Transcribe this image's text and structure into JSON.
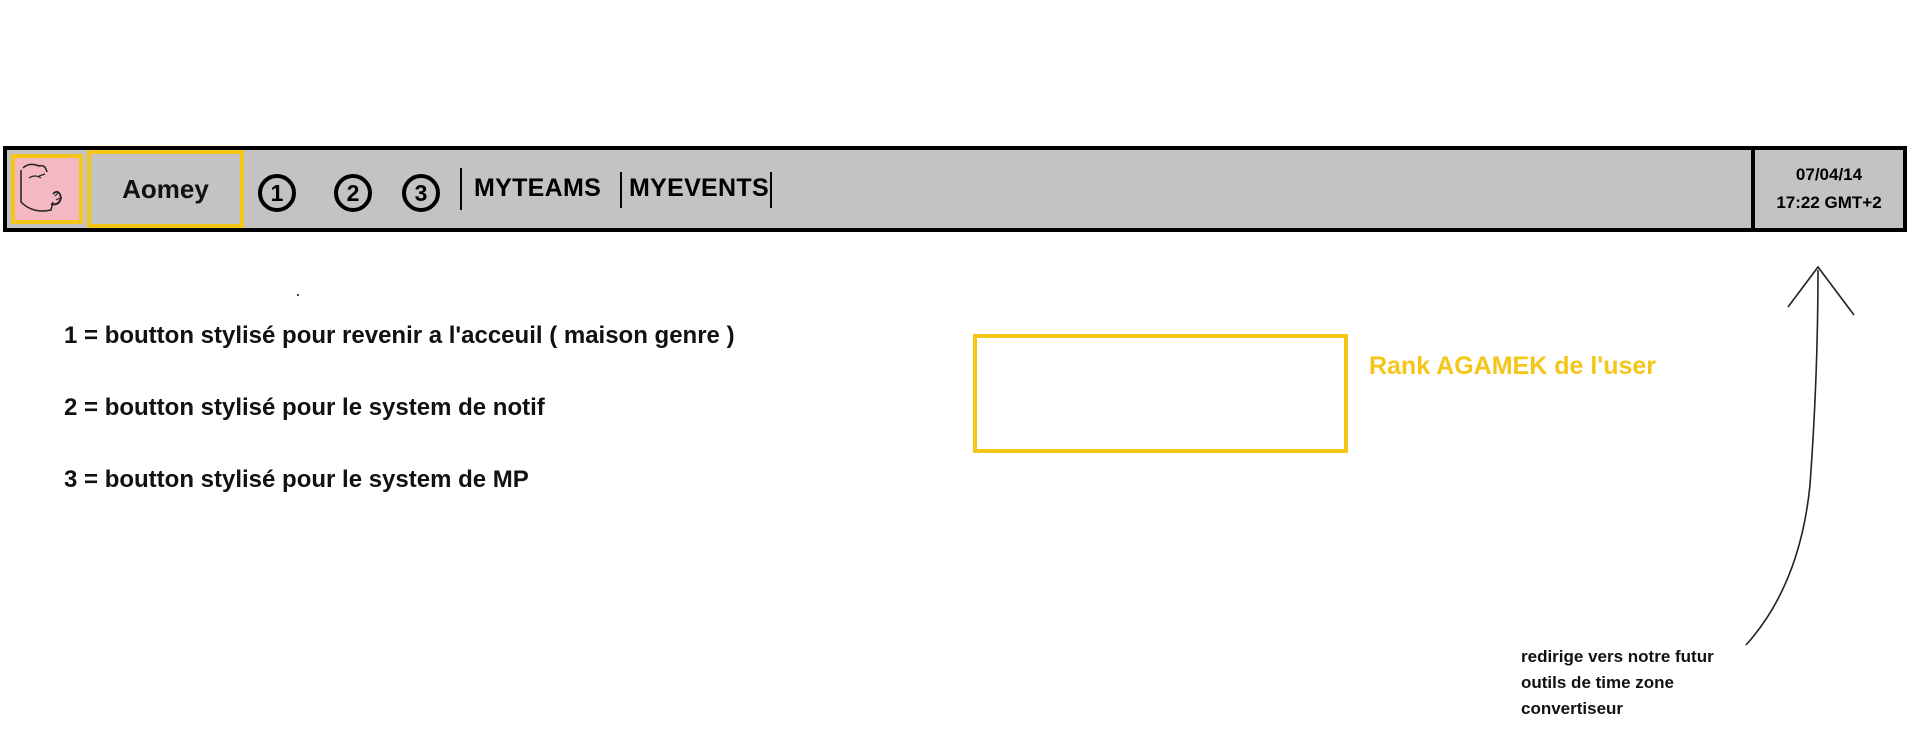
{
  "topbar": {
    "username": "Aomey",
    "buttons": [
      {
        "label": "1",
        "icon": "home-button"
      },
      {
        "label": "2",
        "icon": "notification-button"
      },
      {
        "label": "3",
        "icon": "private-message-button"
      }
    ],
    "nav": {
      "myteams": "MYTEAMS",
      "myevents": "MYEVENTS"
    },
    "date": "07/04/14",
    "time": "17:22 GMT+2"
  },
  "notes": [
    "1 = boutton stylisé pour revenir a l'acceuil ( maison genre )",
    "2 = boutton stylisé pour le system de notif",
    "3 = boutton stylisé pour le system de MP"
  ],
  "rank": {
    "label": "Rank AGAMEK de l'user"
  },
  "annotation": {
    "lines": [
      "redirige vers notre futur",
      "outils de time zone",
      "convertiseur"
    ]
  },
  "colors": {
    "bar_background": "#c3c3c3",
    "accent_yellow": "#f5c518",
    "avatar_pink": "#f4b8c2"
  }
}
